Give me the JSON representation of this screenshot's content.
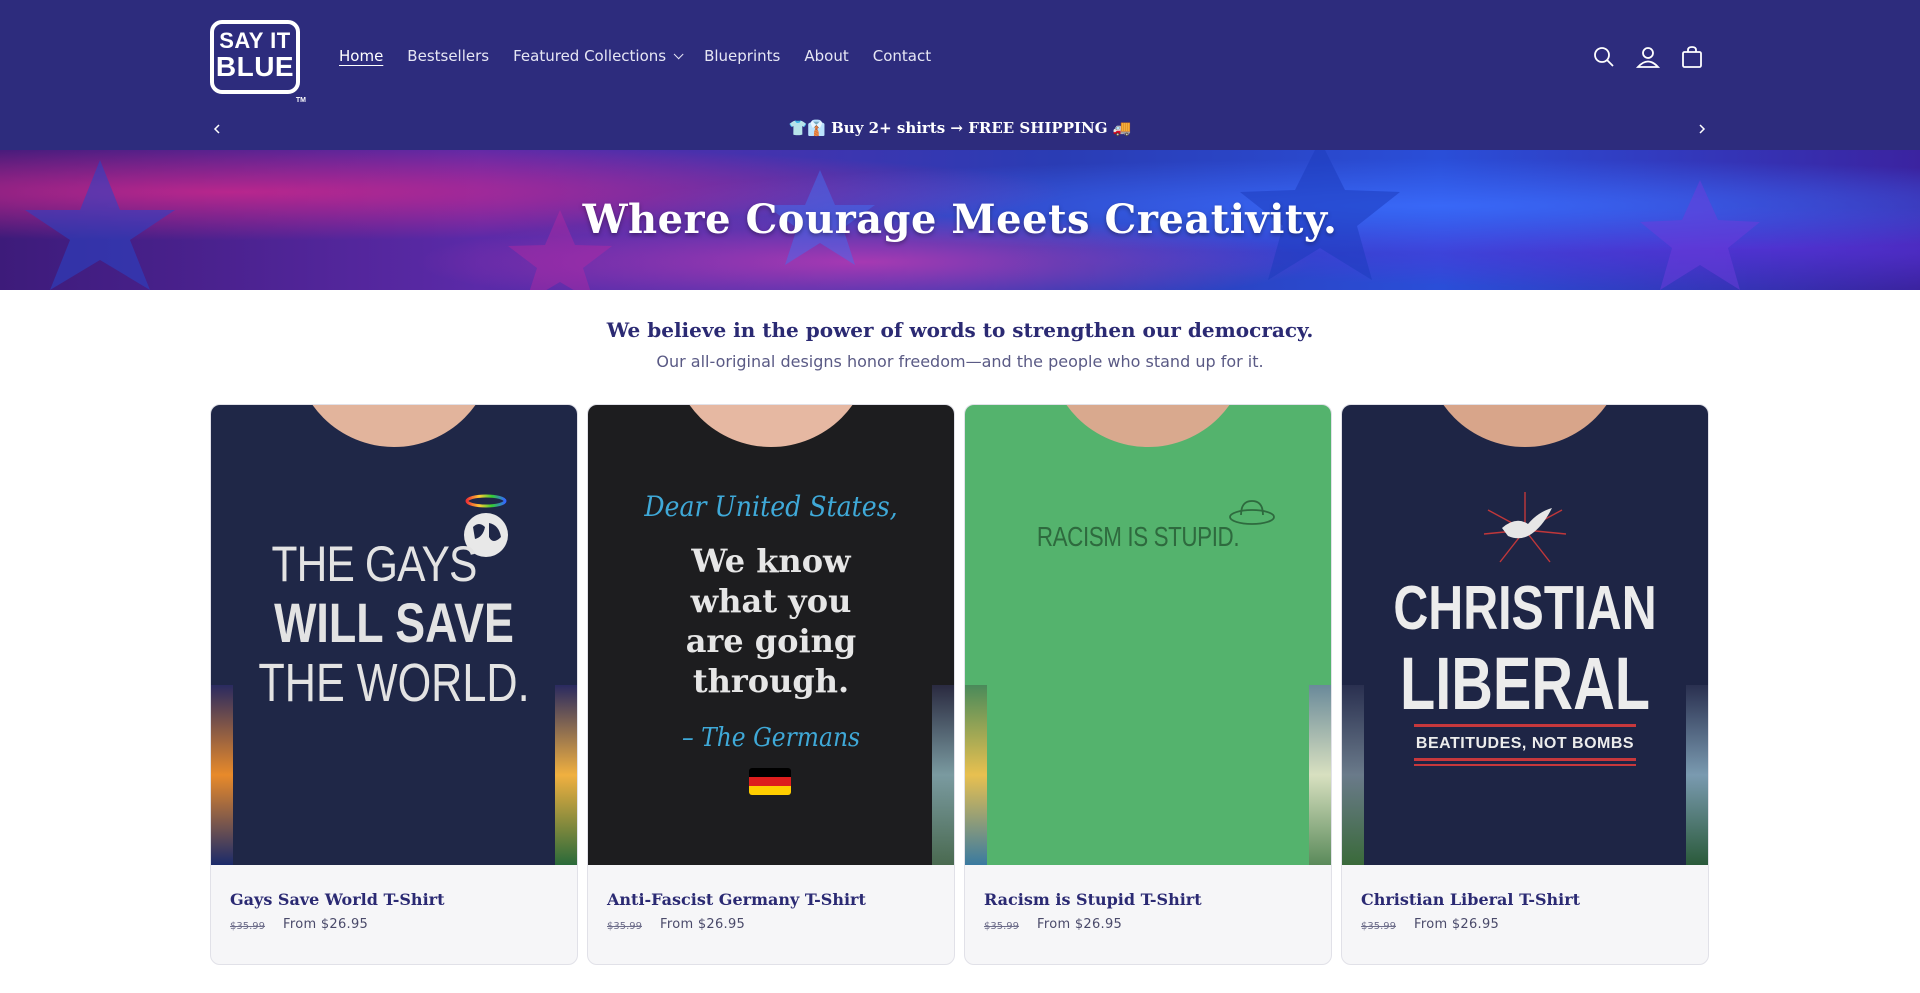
{
  "brand": {
    "logo_top": "SAY IT",
    "logo_bottom": "BLUE",
    "logo_tm": "TM"
  },
  "nav": {
    "items": [
      {
        "label": "Home",
        "active": true
      },
      {
        "label": "Bestsellers"
      },
      {
        "label": "Featured Collections",
        "dropdown": true
      },
      {
        "label": "Blueprints"
      },
      {
        "label": "About"
      },
      {
        "label": "Contact"
      }
    ]
  },
  "header_icons": [
    "search-icon",
    "account-icon",
    "cart-icon"
  ],
  "announcement": {
    "text": "👕👔 Buy 2+ shirts → FREE SHIPPING 🚚"
  },
  "banner": {
    "title": "Where Courage Meets Creativity."
  },
  "intro": {
    "heading": "We believe in the power of words to strengthen our democracy.",
    "sub": "Our all-original designs honor freedom—and the people who stand up for it."
  },
  "products": [
    {
      "title": "Gays Save World T-Shirt",
      "price_old": "$35.99",
      "price_new": "From $26.95",
      "shirt_color": "#1f2747",
      "print": {
        "l1": "THE GAYS",
        "l2": "WILL SAVE",
        "l3": "THE WORLD."
      }
    },
    {
      "title": "Anti-Fascist Germany T-Shirt",
      "price_old": "$35.99",
      "price_new": "From $26.95",
      "shirt_color": "#1d1d1f",
      "print": {
        "l1": "Dear United States,",
        "l2": "We know",
        "l3": "what you",
        "l4": "are going",
        "l5": "through.",
        "l6": "– The Germans"
      }
    },
    {
      "title": "Racism is Stupid T-Shirt",
      "price_old": "$35.99",
      "price_new": "From $26.95",
      "shirt_color": "#54b36d",
      "print": {
        "l1": "RACISM IS STUPID."
      }
    },
    {
      "title": "Christian Liberal T-Shirt",
      "price_old": "$35.99",
      "price_new": "From $26.95",
      "shirt_color": "#1e2545",
      "print": {
        "l1": "CHRISTIAN",
        "l2": "LIBERAL",
        "l3": "BEATITUDES, NOT BOMBS"
      }
    }
  ],
  "colors": {
    "header_bg": "#2d2c7d",
    "brand_text": "#2b2a73",
    "card_bg": "#f6f6f8"
  }
}
